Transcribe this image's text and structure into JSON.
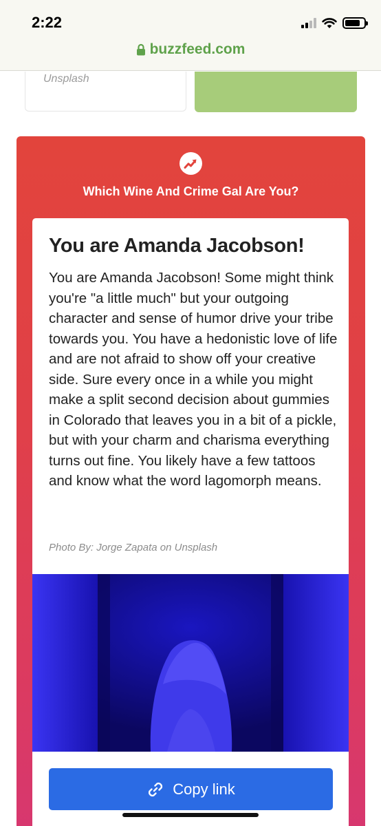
{
  "status_bar": {
    "time": "2:22",
    "icons": [
      "cellular-signal-icon",
      "wifi-icon",
      "battery-icon"
    ]
  },
  "browser": {
    "url": "buzzfeed.com",
    "lock_icon": "lock-icon",
    "url_color": "#5fa24b"
  },
  "previous_row": {
    "credit": "Unsplash",
    "green_tile_color": "#a7cc7a"
  },
  "quiz": {
    "badge_icon": "trending-arrow-icon",
    "title": "Which Wine And Crime Gal Are You?",
    "gradient_top": "#e2443c",
    "gradient_bottom": "#d7376f"
  },
  "result": {
    "heading": "You are Amanda Jacobson!",
    "body": "You are Amanda Jacobson! Some might think you're \"a little much\" but your outgoing character and sense of humor drive your tribe towards you. You have a hedonistic love of life and are not afraid to show off your creative side. Sure every once in a while you might make a split second decision about gummies in Colorado that leaves you in a bit of a pickle, but with your charm and charisma everything turns out fine. You likely have a few tattoos and know what the word lagomorph means.",
    "photo_credit": "Photo By: Jorge Zapata on Unsplash"
  },
  "actions": {
    "copy_link_label": "Copy link",
    "copy_link_icon": "link-icon",
    "button_color": "#2b6be4"
  }
}
